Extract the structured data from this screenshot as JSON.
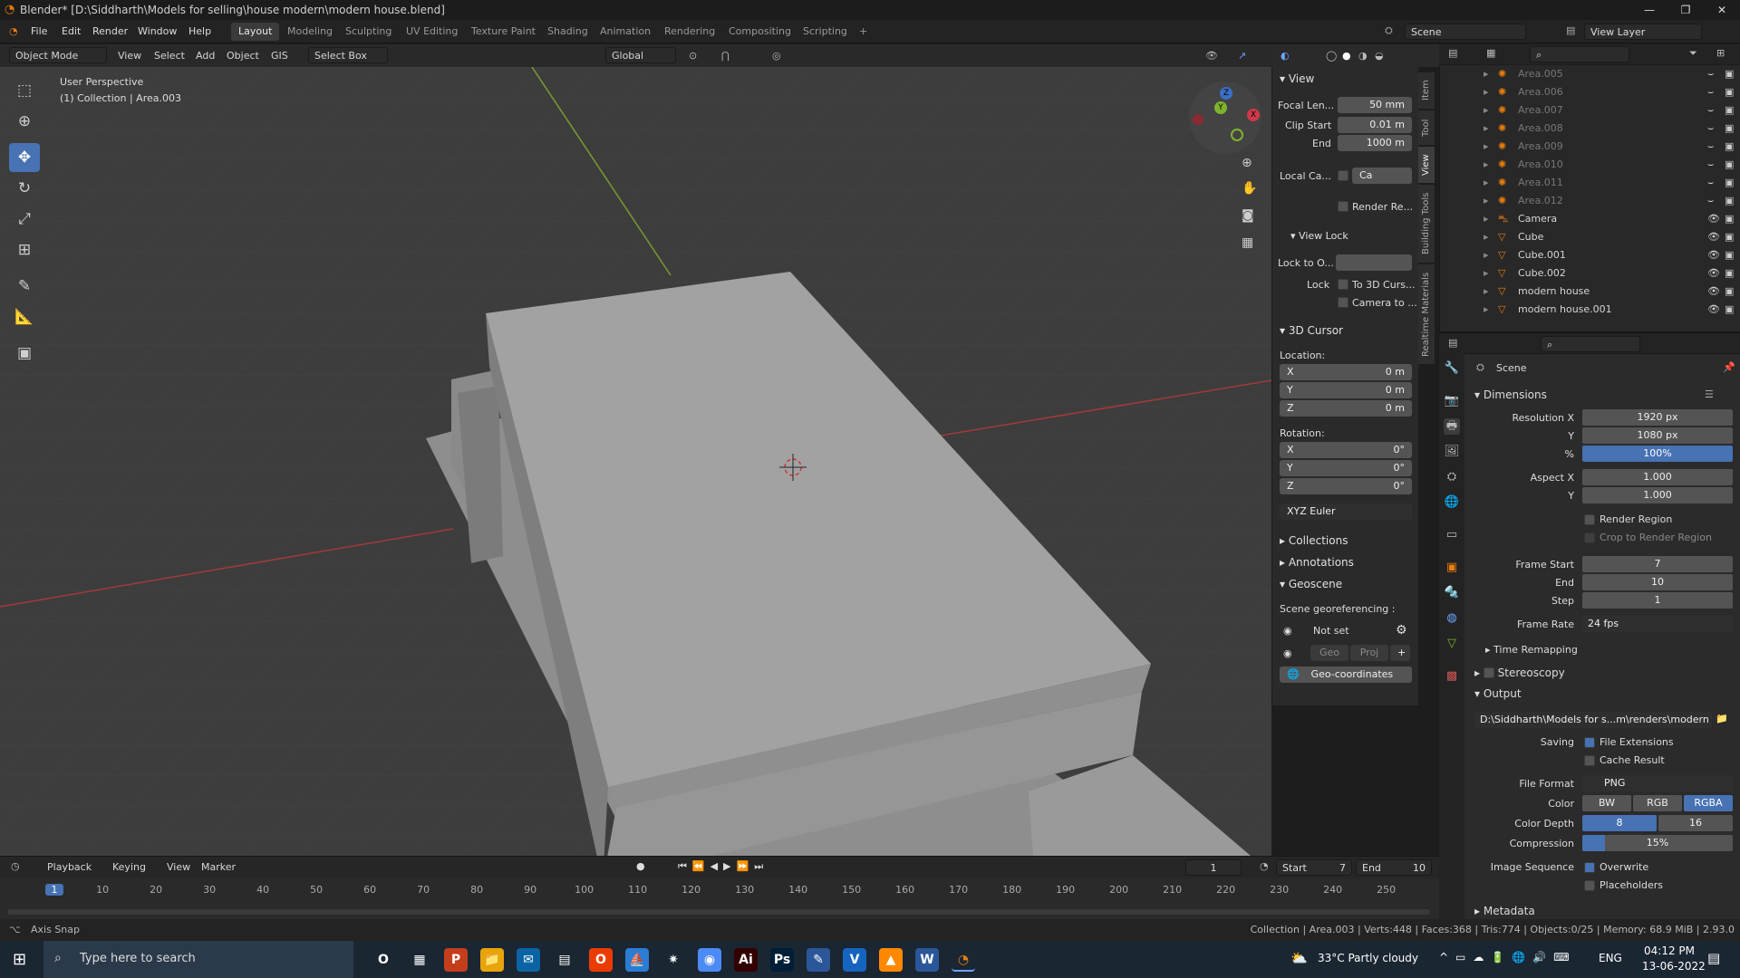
{
  "window": {
    "title": "Blender* [D:\\Siddharth\\Models for selling\\house modern\\modern house.blend]",
    "min": "—",
    "max": "❐",
    "close": "✕"
  },
  "menus": [
    "File",
    "Edit",
    "Render",
    "Window",
    "Help"
  ],
  "workspaces": [
    "Layout",
    "Modeling",
    "Sculpting",
    "UV Editing",
    "Texture Paint",
    "Shading",
    "Animation",
    "Rendering",
    "Compositing",
    "Scripting",
    "+"
  ],
  "scene": {
    "name": "Scene",
    "view_layer": "View Layer"
  },
  "header3d": {
    "mode": "Object Mode",
    "view": "View",
    "select": "Select",
    "add": "Add",
    "object": "Object",
    "gis": "GIS",
    "select_box": "Select Box",
    "orientation": "Global"
  },
  "viewport": {
    "perspective": "User Perspective",
    "collection": "(1) Collection | Area.003"
  },
  "npanel": {
    "tabs": [
      "Item",
      "Tool",
      "View",
      "Building Tools",
      "Realtime Materials"
    ],
    "view_title": "View",
    "focal_label": "Focal Len...",
    "focal": "50 mm",
    "clip_start_label": "Clip Start",
    "clip_start": "0.01 m",
    "end_label": "End",
    "end": "1000 m",
    "local_cam_label": "Local Ca...",
    "local_cam_value": "Ca",
    "render_region": "Render Re...",
    "view_lock": "View Lock",
    "lock_to_label": "Lock to O...",
    "lock_label": "Lock",
    "to_3d_cursor": "To 3D Curs...",
    "camera_to": "Camera to ...",
    "cursor_title": "3D Cursor",
    "location_label": "Location:",
    "loc": [
      {
        "axis": "X",
        "val": "0 m"
      },
      {
        "axis": "Y",
        "val": "0 m"
      },
      {
        "axis": "Z",
        "val": "0 m"
      }
    ],
    "rotation_label": "Rotation:",
    "rot": [
      {
        "axis": "X",
        "val": "0°"
      },
      {
        "axis": "Y",
        "val": "0°"
      },
      {
        "axis": "Z",
        "val": "0°"
      }
    ],
    "euler": "XYZ Euler",
    "collections": "Collections",
    "annotations": "Annotations",
    "geoscene": "Geoscene",
    "georef_label": "Scene georeferencing :",
    "not_set": "Not set",
    "geo": "Geo",
    "proj": "Proj",
    "geo_coords": "Geo-coordinates"
  },
  "outliner": {
    "rows": [
      {
        "name": "Area.005",
        "dim": true
      },
      {
        "name": "Area.006",
        "dim": true
      },
      {
        "name": "Area.007",
        "dim": true
      },
      {
        "name": "Area.008",
        "dim": true
      },
      {
        "name": "Area.009",
        "dim": true
      },
      {
        "name": "Area.010",
        "dim": true
      },
      {
        "name": "Area.011",
        "dim": true
      },
      {
        "name": "Area.012",
        "dim": true
      },
      {
        "name": "Camera",
        "dim": false
      },
      {
        "name": "Cube",
        "dim": false
      },
      {
        "name": "Cube.001",
        "dim": false
      },
      {
        "name": "Cube.002",
        "dim": false
      },
      {
        "name": "modern house",
        "dim": false
      },
      {
        "name": "modern house.001",
        "dim": false
      }
    ]
  },
  "props": {
    "context": "Scene",
    "dimensions": "Dimensions",
    "res_x_label": "Resolution X",
    "res_x": "1920 px",
    "res_y_label": "Y",
    "res_y": "1080 px",
    "pct_label": "%",
    "pct": "100%",
    "aspect_x_label": "Aspect X",
    "aspect_x": "1.000",
    "aspect_y_label": "Y",
    "aspect_y": "1.000",
    "render_region": "Render Region",
    "crop": "Crop to Render Region",
    "frame_start_label": "Frame Start",
    "frame_start": "7",
    "frame_end_label": "End",
    "frame_end": "10",
    "step_label": "Step",
    "step": "1",
    "frame_rate_label": "Frame Rate",
    "frame_rate": "24 fps",
    "time_remap": "Time Remapping",
    "stereoscopy": "Stereoscopy",
    "output": "Output",
    "output_path": "D:\\Siddharth\\Models for s...m\\renders\\modern house",
    "saving_label": "Saving",
    "file_ext": "File Extensions",
    "cache": "Cache Result",
    "format_label": "File Format",
    "format": "PNG",
    "color_label": "Color",
    "bw": "BW",
    "rgb": "RGB",
    "rgba": "RGBA",
    "depth_label": "Color Depth",
    "d8": "8",
    "d16": "16",
    "compression_label": "Compression",
    "compression": "15%",
    "compression_level": 0.15,
    "imgseq_label": "Image Sequence",
    "overwrite": "Overwrite",
    "placeholders": "Placeholders",
    "metadata": "Metadata"
  },
  "timeline": {
    "menus": [
      "Playback",
      "Keying",
      "View",
      "Marker"
    ],
    "current": "1",
    "start_label": "Start",
    "start": "7",
    "end_label": "End",
    "end": "10",
    "ticks": [
      "1",
      "10",
      "20",
      "30",
      "40",
      "50",
      "60",
      "70",
      "80",
      "90",
      "100",
      "110",
      "120",
      "130",
      "140",
      "150",
      "160",
      "170",
      "180",
      "190",
      "200",
      "210",
      "220",
      "230",
      "240",
      "250"
    ]
  },
  "status": {
    "left": "Axis Snap",
    "right": "Collection | Area.003 | Verts:448 | Faces:368 | Tris:774 | Objects:0/25 | Memory: 68.9 MiB | 2.93.0"
  },
  "taskbar": {
    "search": "Type here to search",
    "weather": "33°C  Partly cloudy",
    "lang": "ENG",
    "time": "04:12 PM",
    "date": "13-06-2022",
    "apps": [
      "O",
      "▦",
      "P",
      "📁",
      "✉",
      "▤",
      "O",
      "⛵",
      "✷",
      "◉",
      "Ai",
      "Ps",
      "✎",
      "V",
      "▲",
      "W",
      "◔"
    ]
  },
  "colors": {
    "accent": "#4772b3",
    "bg": "#3d3d3d",
    "panel": "#2a2a2a",
    "x_axis": "#a33a3a",
    "y_axis": "#7a9a2e"
  }
}
